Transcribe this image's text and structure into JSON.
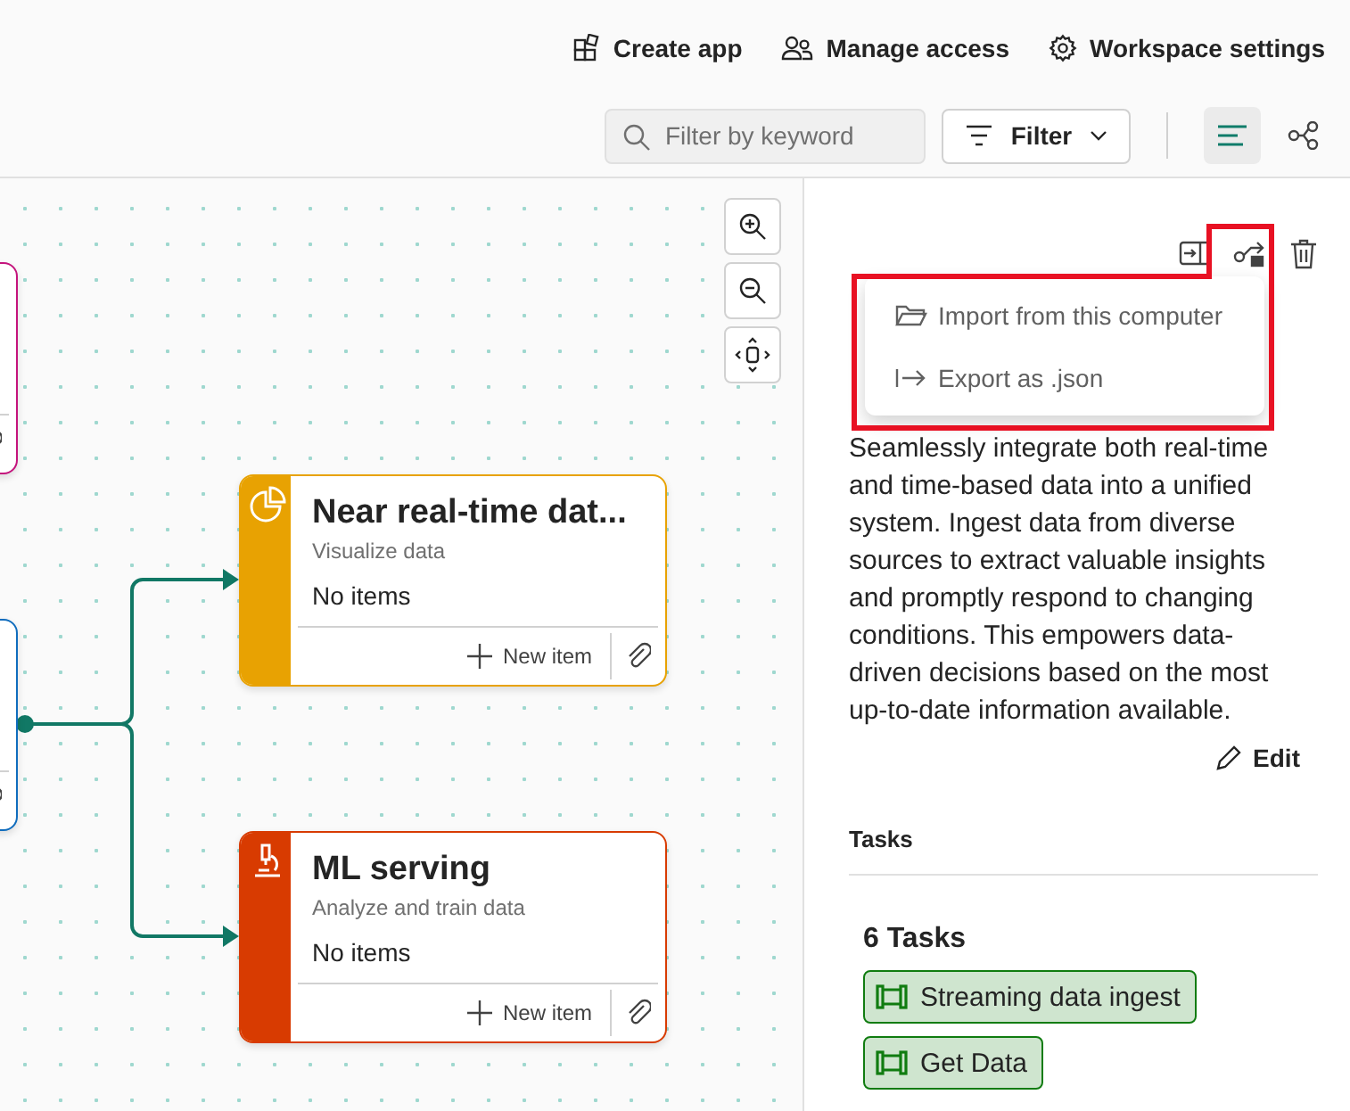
{
  "header": {
    "actions": [
      {
        "label": "Create app"
      },
      {
        "label": "Manage access"
      },
      {
        "label": "Workspace settings"
      }
    ]
  },
  "toolbar": {
    "search": {
      "placeholder": "Filter by keyword"
    },
    "filter": {
      "label": "Filter"
    },
    "views": [
      {
        "selected": true
      },
      {
        "selected": false
      }
    ]
  },
  "canvas": {
    "nodes": [
      {
        "color": "#c4137c"
      },
      {
        "color": "#0f6cbd"
      },
      {
        "title": "Near real-time dat...",
        "subtitle": "Visualize data",
        "status": "No items",
        "action": "New item",
        "color": "#e8a202"
      },
      {
        "title": "ML serving",
        "subtitle": "Analyze and train data",
        "status": "No items",
        "action": "New item",
        "color": "#d83b01"
      }
    ]
  },
  "panel": {
    "description": "Seamlessly integrate both real-time and time-based data into a unified system. Ingest data from diverse sources to extract valuable insights and promptly respond to changing conditions. This empowers data-driven decisions based on the most up-to-date information available.",
    "edit": "Edit",
    "menu": [
      {
        "label": "Import from this computer"
      },
      {
        "label": "Export as .json"
      }
    ],
    "tasks_heading": "Tasks",
    "task_count": "6 Tasks",
    "tasks": [
      {
        "label": "Streaming data ingest",
        "color": "#107c10"
      },
      {
        "label": "Get Data",
        "color": "#107c10"
      }
    ]
  }
}
